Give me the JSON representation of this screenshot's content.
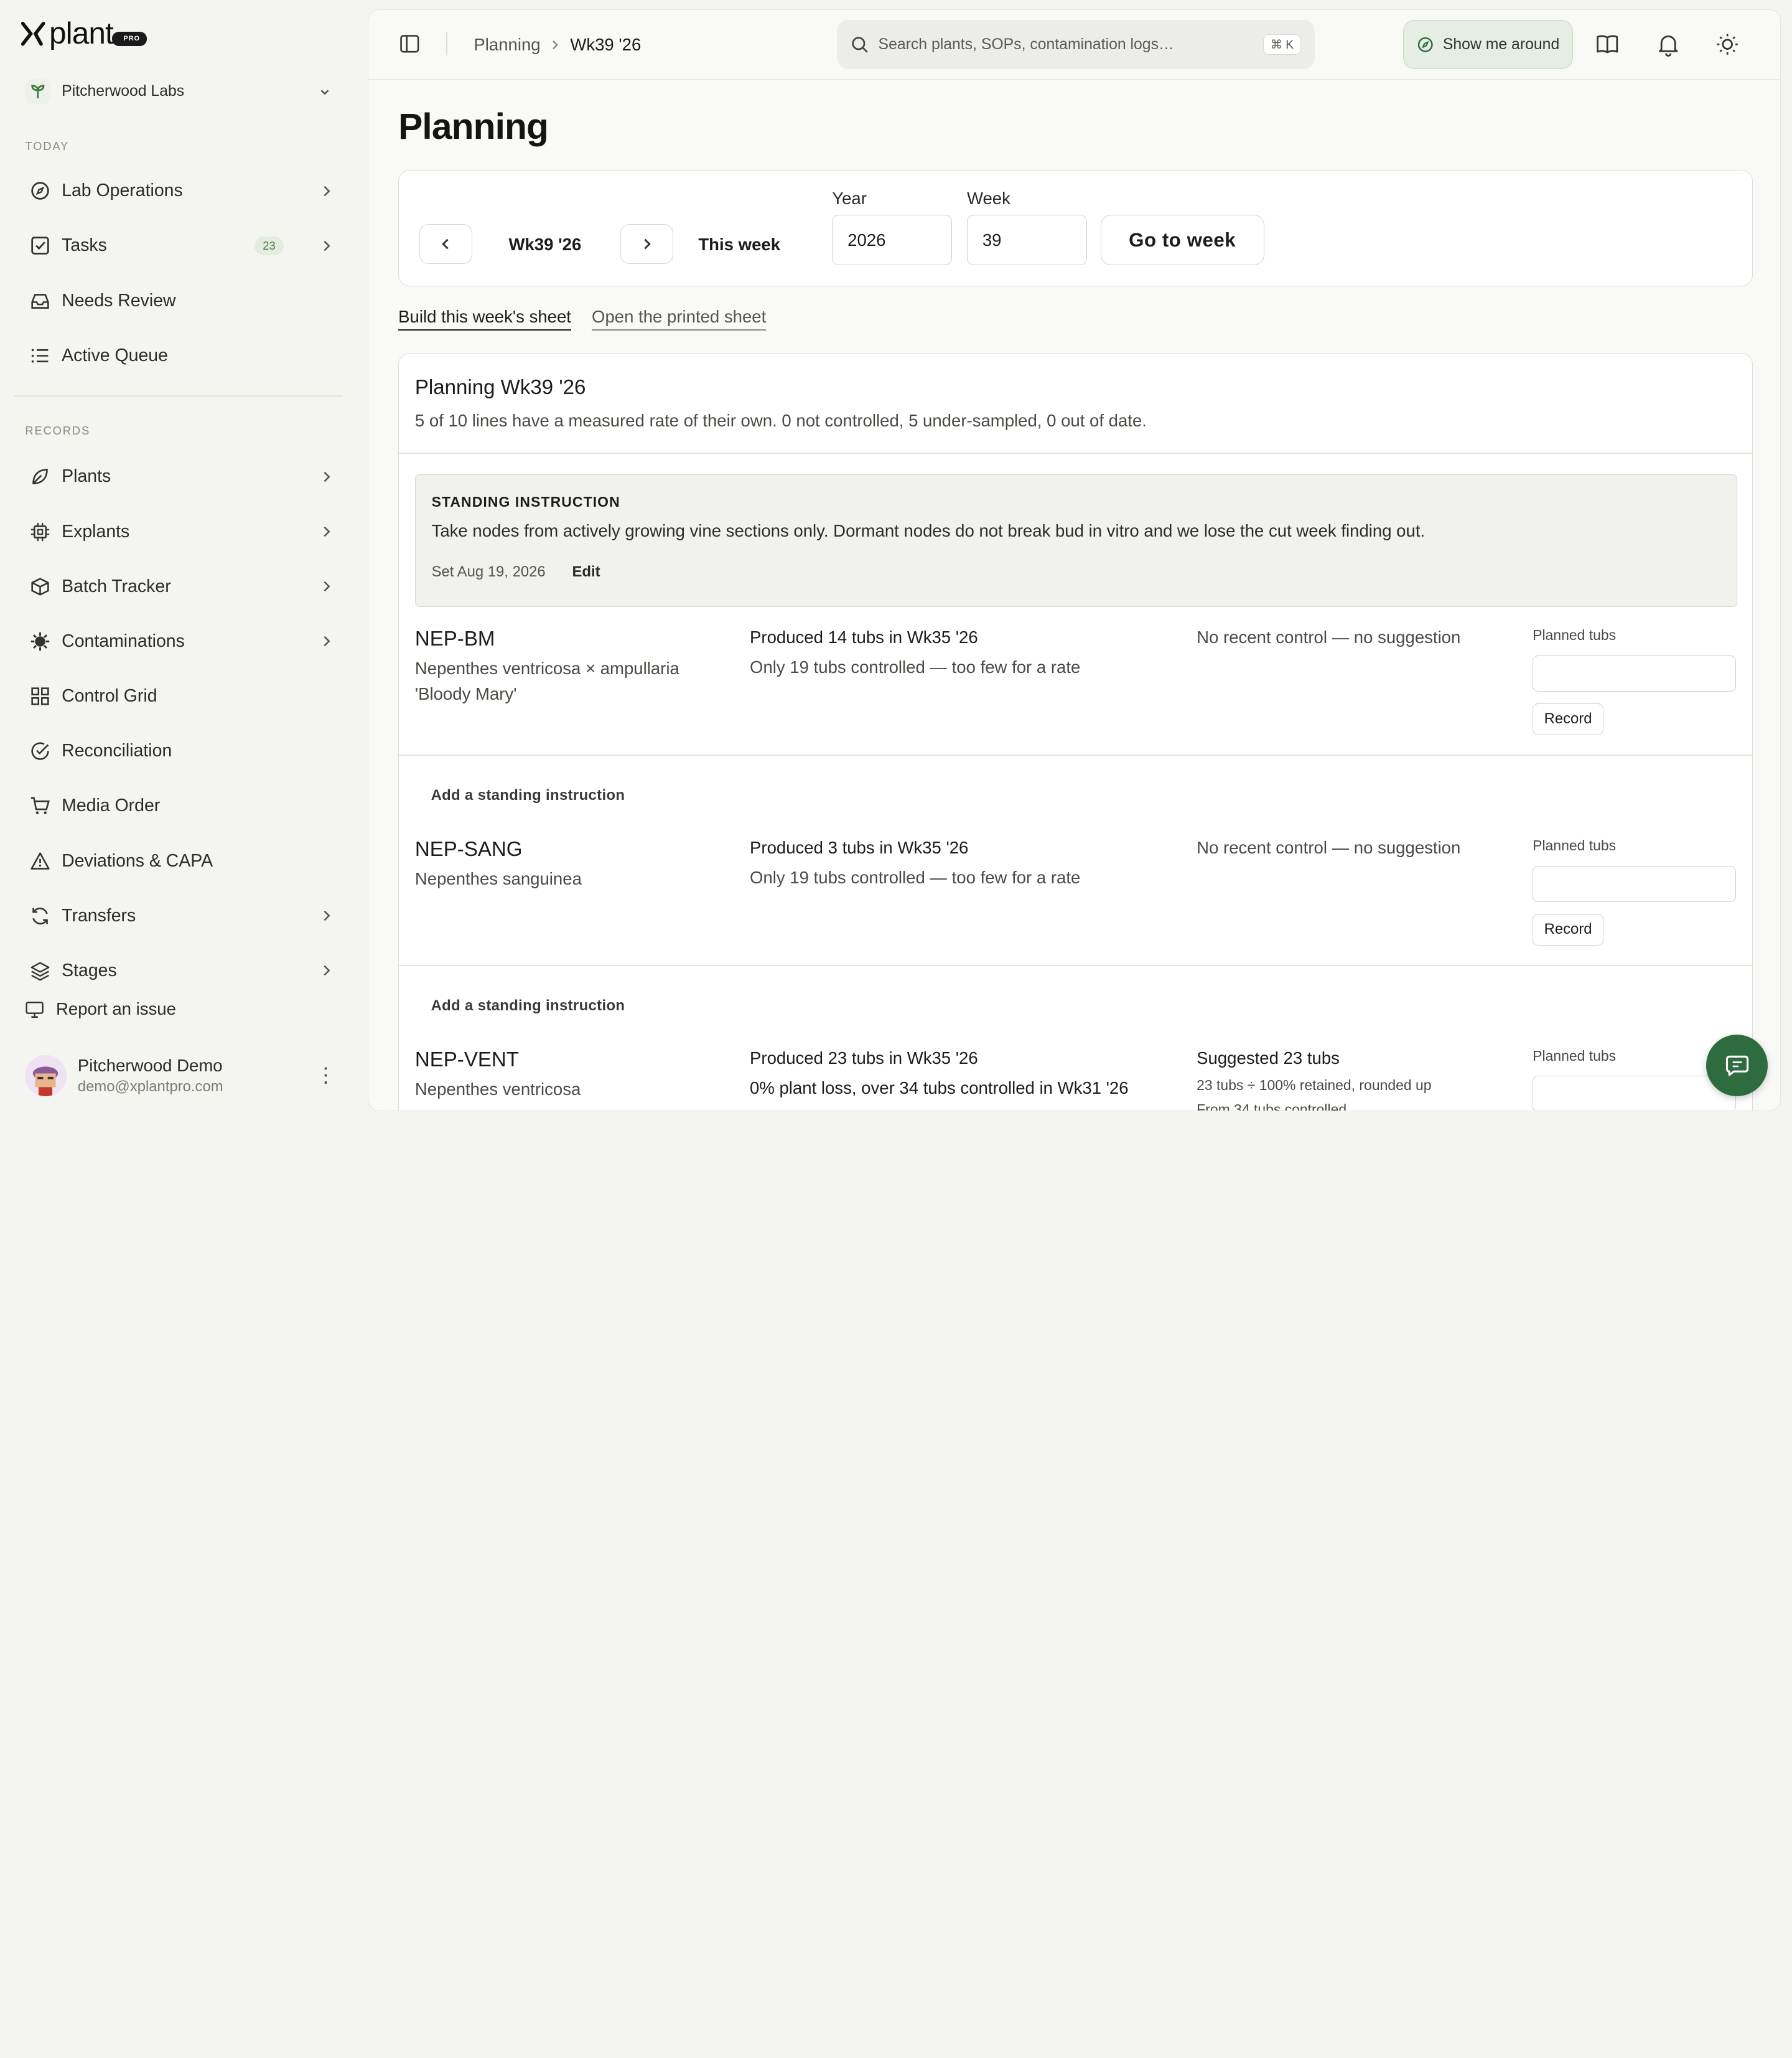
{
  "brand": {
    "logo_text": "plant",
    "badge": "PRO"
  },
  "org": {
    "name": "Pitcherwood Labs"
  },
  "sidebar": {
    "today_label": "TODAY",
    "records_label": "RECORDS",
    "items": [
      {
        "label": "Lab Operations",
        "icon": "compass-icon"
      },
      {
        "label": "Tasks",
        "icon": "checkbox-icon",
        "badge": "23"
      },
      {
        "label": "Needs Review",
        "icon": "inbox-icon"
      },
      {
        "label": "Active Queue",
        "icon": "list-icon"
      },
      {
        "label": "Plants",
        "icon": "leaf-icon"
      },
      {
        "label": "Explants",
        "icon": "chip-icon"
      },
      {
        "label": "Batch Tracker",
        "icon": "box-icon"
      },
      {
        "label": "Contaminations",
        "icon": "virus-icon"
      },
      {
        "label": "Control Grid",
        "icon": "grid-icon"
      },
      {
        "label": "Reconciliation",
        "icon": "check-circle-icon"
      },
      {
        "label": "Media Order",
        "icon": "cart-icon"
      },
      {
        "label": "Deviations & CAPA",
        "icon": "warning-icon"
      },
      {
        "label": "Transfers",
        "icon": "refresh-icon"
      },
      {
        "label": "Stages",
        "icon": "layers-icon"
      }
    ],
    "report": "Report an issue",
    "user": {
      "name": "Pitcherwood Demo",
      "email": "demo@xplantpro.com"
    }
  },
  "topbar": {
    "breadcrumb": [
      "Planning",
      "Wk39 '26"
    ],
    "search_placeholder": "Search plants, SOPs, contamination logs…",
    "search_shortcut": "⌘ K",
    "tour_label": "Show me around"
  },
  "page": {
    "title": "Planning",
    "week_label": "Wk39 '26",
    "this_week": "This week",
    "year_label": "Year",
    "year_value": "2026",
    "week_field_label": "Week",
    "week_value": "39",
    "go_label": "Go to week",
    "tabs": [
      "Build this week's sheet",
      "Open the printed sheet"
    ]
  },
  "sheet": {
    "title": "Planning Wk39 '26",
    "summary": "5 of 10 lines have a measured rate of their own. 0 not controlled, 5 under-sampled, 0 out of date.",
    "instruction": {
      "heading": "STANDING INSTRUCTION",
      "text": "Take nodes from actively growing vine sections only. Dormant nodes do not break bud in vitro and we lose the cut week finding out.",
      "date": "Set Aug 19, 2026",
      "edit": "Edit"
    },
    "add_instruction": "Add a standing instruction",
    "planned_label": "Planned tubs",
    "record_label": "Record",
    "rows": [
      {
        "code": "NEP-BM",
        "name": "Nepenthes ventricosa × ampullaria 'Bloody Mary'",
        "produced": "Produced 14 tubs in Wk35 '26",
        "control": "Only 19 tubs controlled — too few for a rate",
        "suggestion": "No recent control — no suggestion"
      },
      {
        "code": "NEP-SANG",
        "name": "Nepenthes sanguinea",
        "produced": "Produced 3 tubs in Wk35 '26",
        "control": "Only 19 tubs controlled — too few for a rate",
        "suggestion": "No recent control — no suggestion"
      },
      {
        "code": "NEP-VENT",
        "name": "Nepenthes ventricosa",
        "produced": "Produced 23 tubs in Wk35 '26",
        "control": "0% plant loss, over 34 tubs controlled in Wk31 '26",
        "suggestion": "Suggested 23 tubs",
        "suggestion_detail": "23 tubs ÷ 100% retained, rounded up",
        "suggestion_detail2": "From 34 tubs controlled"
      }
    ]
  }
}
